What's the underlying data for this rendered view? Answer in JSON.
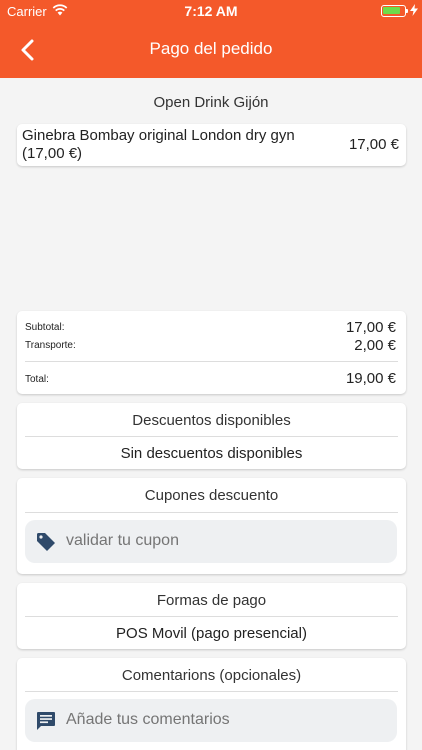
{
  "status_bar": {
    "carrier": "Carrier",
    "time": "7:12 AM",
    "battery_level": 0.85,
    "icons": [
      "wifi-icon",
      "battery-icon",
      "charging-bolt-icon"
    ]
  },
  "nav": {
    "title": "Pago del pedido",
    "back_icon": "chevron-left-icon",
    "color": "#f4592a"
  },
  "store": {
    "name": "Open Drink Gijón"
  },
  "order": {
    "items": [
      {
        "name": "Ginebra Bombay original London dry gyn (17,00 €)",
        "price": "17,00 €"
      }
    ]
  },
  "totals": {
    "subtotal_label": "Subtotal:",
    "subtotal_value": "17,00 €",
    "shipping_label": "Transporte:",
    "shipping_value": "2,00 €",
    "total_label": "Total:",
    "total_value": "19,00 €"
  },
  "discounts": {
    "title": "Descuentos disponibles",
    "value": "Sin descuentos disponibles"
  },
  "coupons": {
    "title": "Cupones descuento",
    "placeholder": "validar tu cupon",
    "icon": "tag-icon"
  },
  "payment": {
    "title": "Formas de pago",
    "method": "POS Movil (pago presencial)"
  },
  "comments": {
    "title": "Comentarions (opcionales)",
    "placeholder": "Añade tus comentarios",
    "icon": "comment-icon"
  },
  "colors": {
    "accent": "#f4592a",
    "icon_dark": "#2f4a6a",
    "placeholder": "#6b7d8c"
  }
}
